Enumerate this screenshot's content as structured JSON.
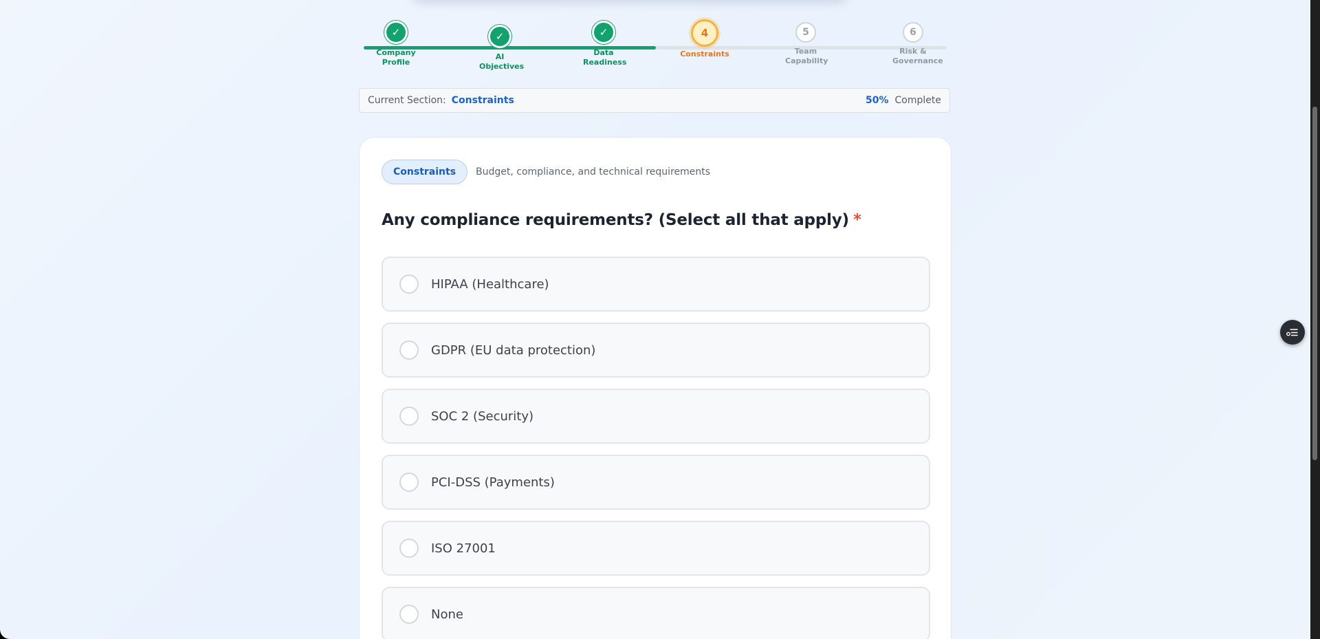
{
  "stepper": {
    "progress": 0.5,
    "steps": [
      {
        "label": "Company Profile",
        "status": "done",
        "number": "1"
      },
      {
        "label": "AI Objectives",
        "status": "done",
        "number": "2"
      },
      {
        "label": "Data Readiness",
        "status": "done",
        "number": "3"
      },
      {
        "label": "Constraints",
        "status": "current",
        "number": "4"
      },
      {
        "label": "Team Capability",
        "status": "todo",
        "number": "5"
      },
      {
        "label": "Risk & Governance",
        "status": "todo",
        "number": "6"
      }
    ],
    "check_glyph": "✓"
  },
  "section_bar": {
    "prefix": "Current Section:",
    "section_name": "Constraints",
    "percent": "50%",
    "complete_label": "Complete"
  },
  "card": {
    "tag": "Constraints",
    "tag_description": "Budget, compliance, and technical requirements",
    "question": "Any compliance requirements? (Select all that apply)",
    "required_marker": "*",
    "options": [
      {
        "label": "HIPAA (Healthcare)"
      },
      {
        "label": "GDPR (EU data protection)"
      },
      {
        "label": "SOC 2 (Security)"
      },
      {
        "label": "PCI-DSS (Payments)"
      },
      {
        "label": "ISO 27001"
      },
      {
        "label": "None"
      }
    ]
  },
  "floating_button": {
    "icon": "settings-list-icon"
  },
  "colors": {
    "accent": "#1a63c7",
    "done": "#12a26f",
    "current": "#e6761a",
    "required": "#e0553e"
  }
}
